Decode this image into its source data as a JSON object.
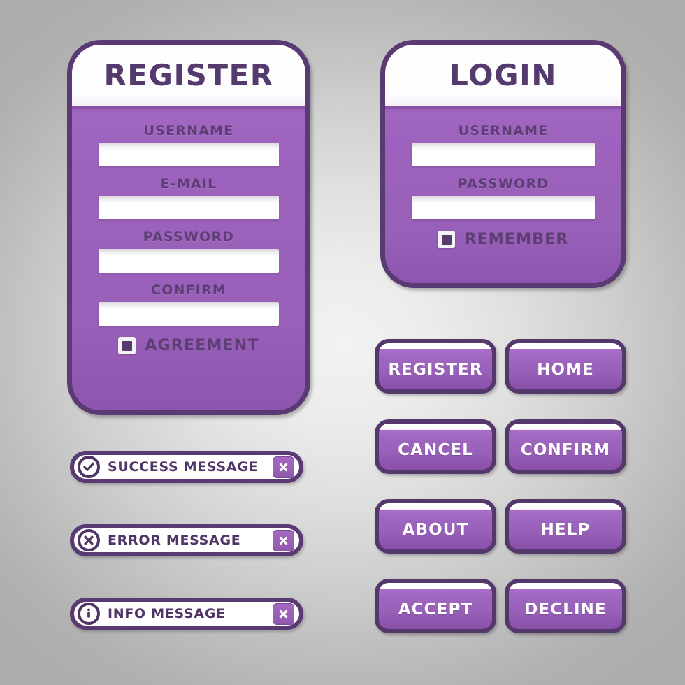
{
  "theme": {
    "purple": "#9d62bd",
    "purple_dark": "#5a3a72",
    "purple_text": "#553a6d",
    "label_text": "#5d3e74",
    "white": "#ffffff",
    "background_center": "#f2f2f2",
    "background_edge": "#adadad"
  },
  "register_panel": {
    "title": "REGISTER",
    "fields": [
      {
        "label": "USERNAME",
        "value": "",
        "placeholder": ""
      },
      {
        "label": "E-MAIL",
        "value": "",
        "placeholder": ""
      },
      {
        "label": "PASSWORD",
        "value": "",
        "placeholder": ""
      },
      {
        "label": "CONFIRM",
        "value": "",
        "placeholder": ""
      }
    ],
    "checkbox": {
      "label": "AGREEMENT",
      "checked": true,
      "icon": "checkbox-filled-icon"
    }
  },
  "login_panel": {
    "title": "LOGIN",
    "fields": [
      {
        "label": "USERNAME",
        "value": "",
        "placeholder": ""
      },
      {
        "label": "PASSWORD",
        "value": "",
        "placeholder": ""
      }
    ],
    "checkbox": {
      "label": "REMEMBER",
      "checked": true,
      "icon": "checkbox-filled-icon"
    }
  },
  "messages": [
    {
      "type": "success",
      "text": "SUCCESS MESSAGE",
      "icon": "check-circle-icon",
      "close_icon": "close-x-icon"
    },
    {
      "type": "error",
      "text": "ERROR MESSAGE",
      "icon": "x-circle-icon",
      "close_icon": "close-x-icon"
    },
    {
      "type": "info",
      "text": "INFO MESSAGE",
      "icon": "info-circle-icon",
      "close_icon": "close-x-icon"
    }
  ],
  "buttons": [
    {
      "label": "REGISTER"
    },
    {
      "label": "HOME"
    },
    {
      "label": "CANCEL"
    },
    {
      "label": "CONFIRM"
    },
    {
      "label": "ABOUT"
    },
    {
      "label": "HELP"
    },
    {
      "label": "ACCEPT"
    },
    {
      "label": "DECLINE"
    }
  ]
}
